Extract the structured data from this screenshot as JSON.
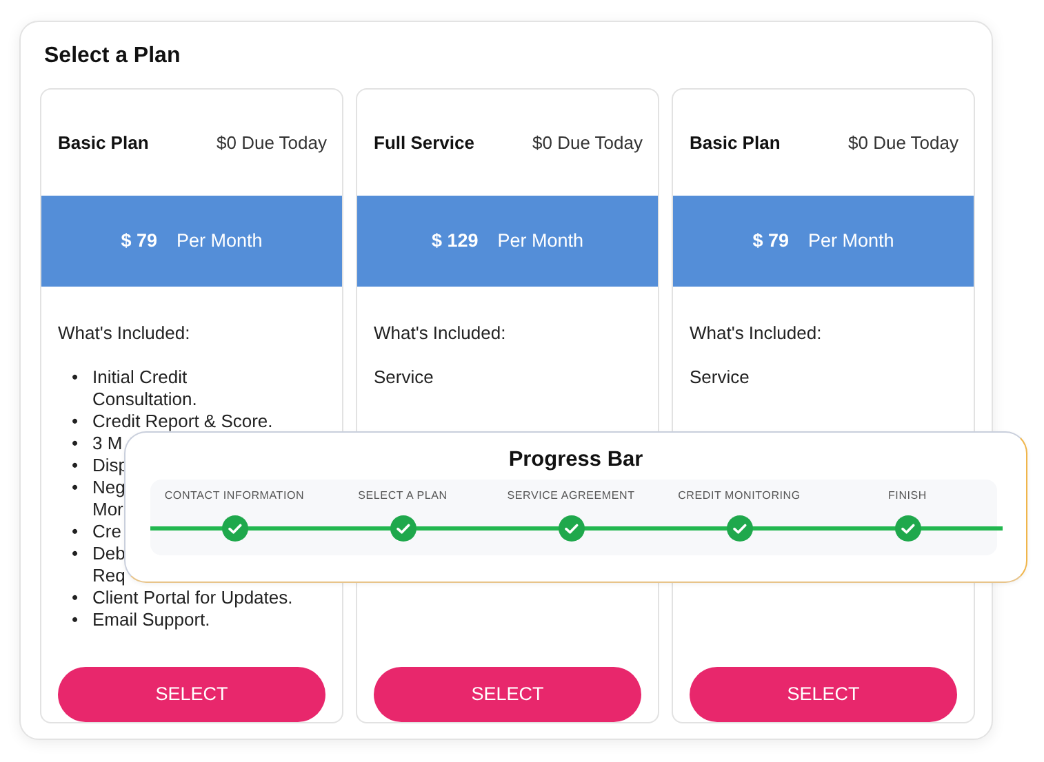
{
  "title": "Select a Plan",
  "plans": [
    {
      "name": "Basic Plan",
      "due": "$0 Due Today",
      "price": "$ 79",
      "period": "Per Month",
      "included_heading": "What's Included:",
      "kind": "bullets",
      "marker": "•",
      "features": [
        {
          "lines": [
            "Initial Credit Consultation."
          ]
        },
        {
          "lines": [
            "Credit Report & Score."
          ]
        },
        {
          "lines": [
            "3 M"
          ]
        },
        {
          "lines": [
            "Disp"
          ]
        },
        {
          "lines": [
            "Neg",
            "Mor"
          ]
        },
        {
          "lines": [
            "Cre"
          ]
        },
        {
          "lines": [
            "Deb",
            "Req"
          ]
        },
        {
          "lines": [
            "Client Portal for Updates."
          ]
        },
        {
          "lines": [
            "Email Support."
          ]
        }
      ],
      "button": "SELECT"
    },
    {
      "name": "Full Service",
      "due": "$0 Due Today",
      "price": "$ 129",
      "period": "Per Month",
      "included_heading": "What's Included:",
      "kind": "plain",
      "features": [
        "Service"
      ],
      "button": "SELECT"
    },
    {
      "name": "Basic Plan",
      "due": "$0 Due Today",
      "price": "$ 79",
      "period": "Per Month",
      "included_heading": "What's Included:",
      "kind": "plain",
      "features": [
        "Service"
      ],
      "button": "SELECT"
    }
  ],
  "progress": {
    "title": "Progress Bar",
    "steps": [
      {
        "label": "CONTACT INFORMATION",
        "completed": true
      },
      {
        "label": "SELECT A PLAN",
        "completed": true
      },
      {
        "label": "SERVICE AGREEMENT",
        "completed": true
      },
      {
        "label": "CREDIT MONITORING",
        "completed": true
      },
      {
        "label": "FINISH",
        "completed": true
      }
    ]
  }
}
